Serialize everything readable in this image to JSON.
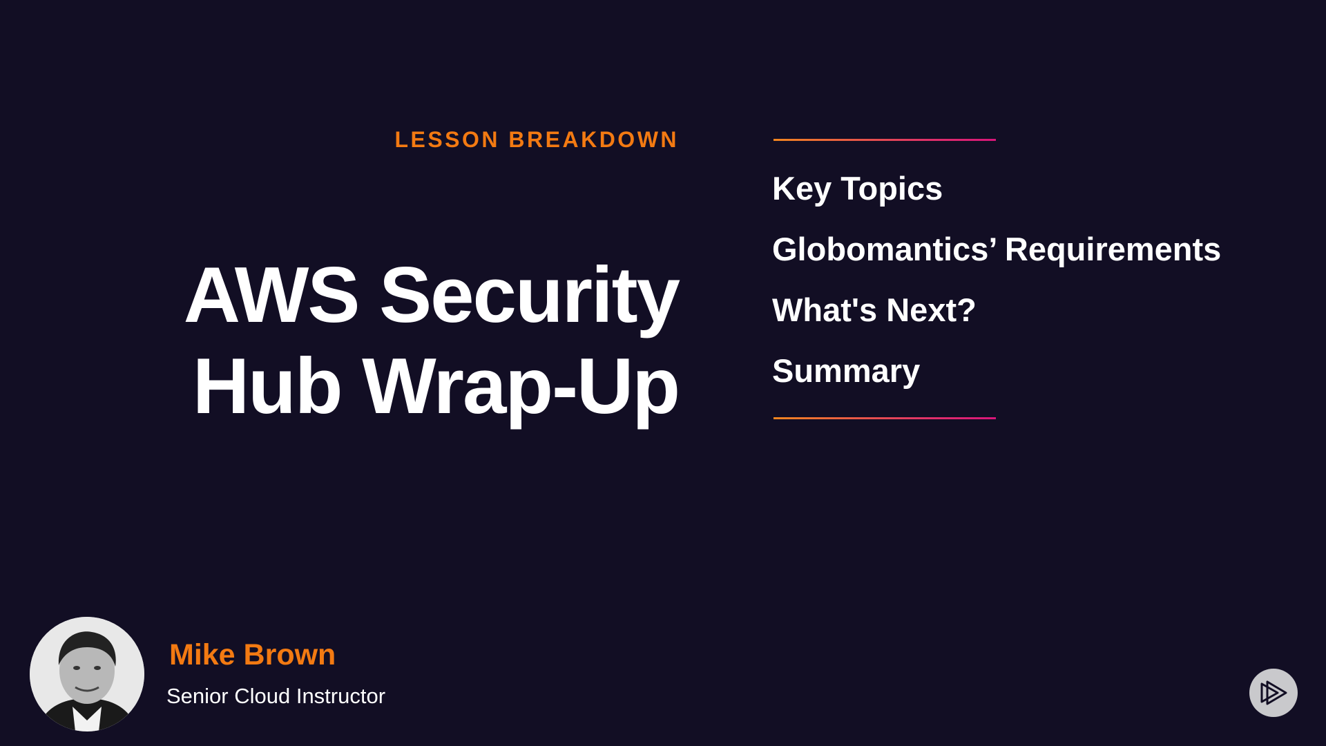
{
  "slide": {
    "eyebrow": "LESSON BREAKDOWN",
    "title_lines": [
      "AWS Security",
      "Hub Wrap-Up"
    ],
    "agenda": [
      "Key Topics",
      "Globomantics’ Requirements",
      "What's Next?",
      "Summary"
    ]
  },
  "presenter": {
    "name": "Mike Brown",
    "role": "Senior Cloud Instructor"
  },
  "colors": {
    "background": "#120e24",
    "accent": "#f37a12",
    "rule_start": "#f3861f",
    "rule_end": "#d8157a"
  }
}
